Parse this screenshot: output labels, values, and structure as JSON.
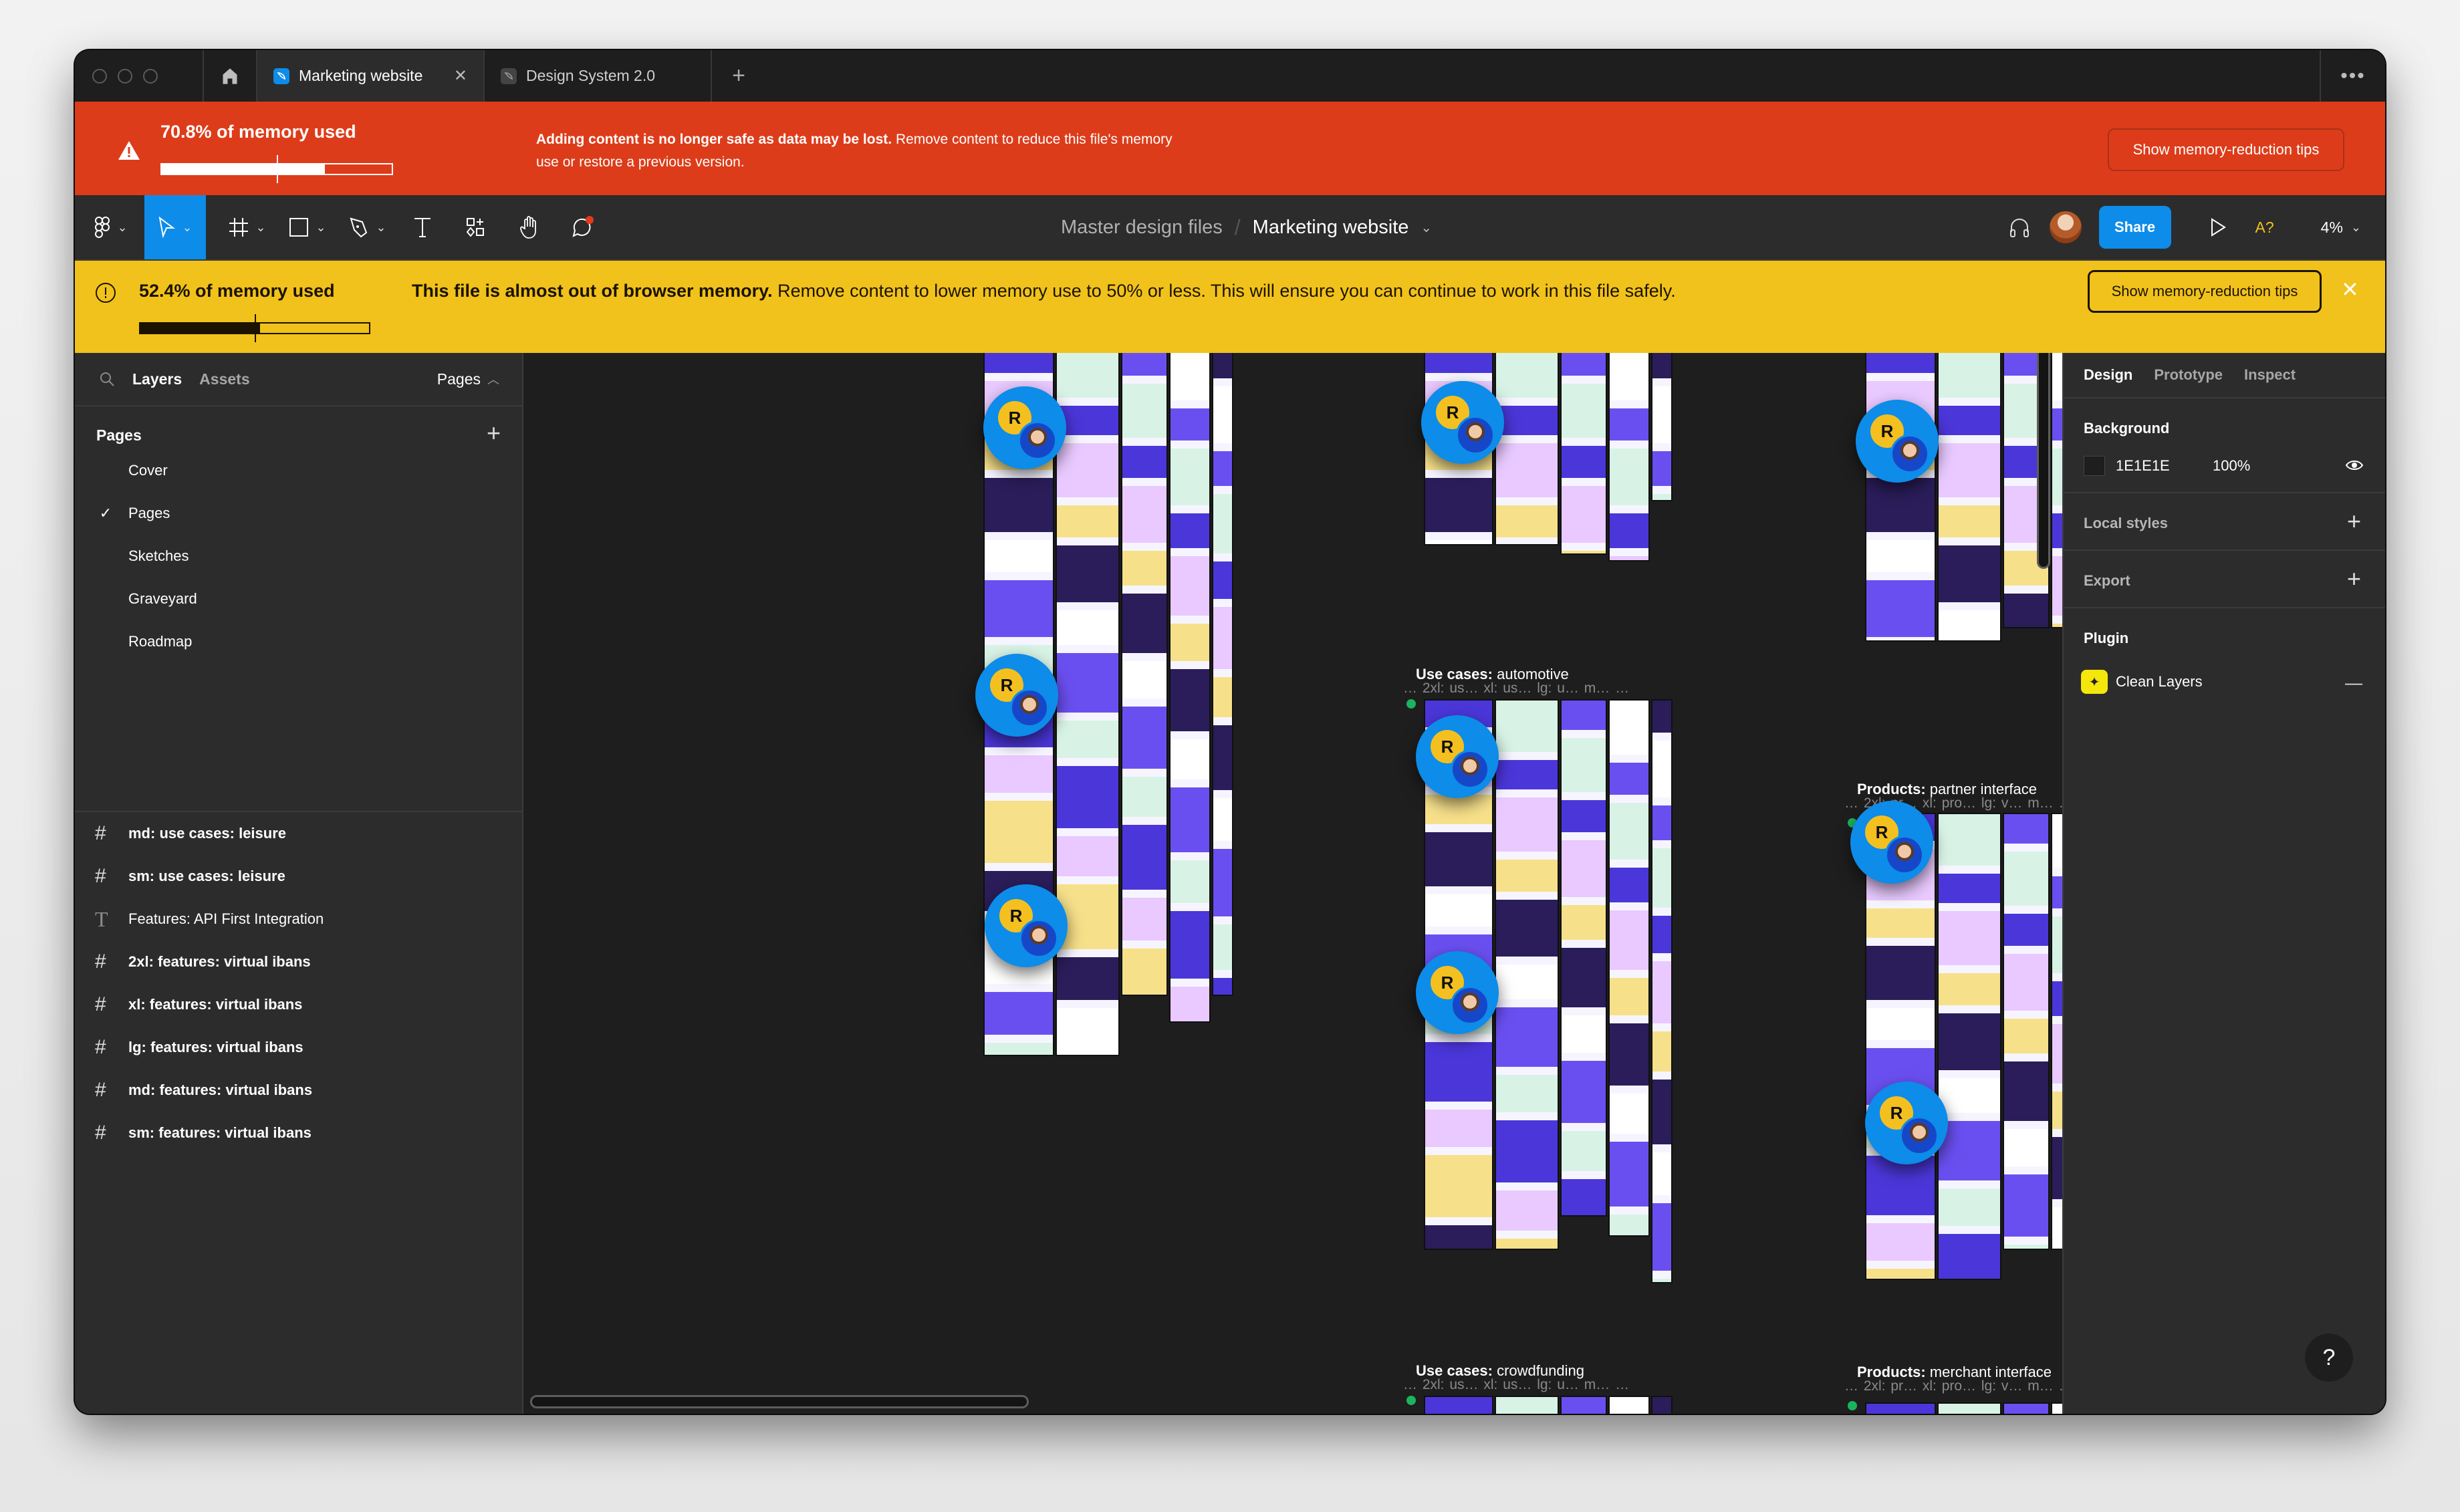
{
  "window": {
    "tabs": [
      {
        "label": "Marketing website",
        "active": true,
        "close_icon": "close-icon"
      },
      {
        "label": "Design System 2.0",
        "active": false
      }
    ],
    "new_tab_label": "+",
    "more_label": "•••"
  },
  "critical_banner": {
    "memory_label": "70.8% of memory used",
    "memory_percent": 70.8,
    "message_bold": "Adding content is no longer safe as data may be lost.",
    "message_rest": " Remove content to reduce this file's memory use or restore a previous version.",
    "button_label": "Show memory-reduction tips",
    "color": "#dd3c1a"
  },
  "toolbar": {
    "tools": [
      "main-menu",
      "move",
      "frame",
      "shape",
      "pen",
      "text",
      "resources",
      "hand",
      "comment"
    ],
    "breadcrumb": {
      "parent": "Master design files",
      "separator": "/",
      "current": "Marketing website"
    },
    "share_label": "Share",
    "a11y_label": "A?",
    "zoom_label": "4%",
    "accent": "#0d8ce9"
  },
  "warning_banner": {
    "memory_label": "52.4% of memory used",
    "memory_percent": 52.4,
    "message_bold": "This file is almost out of browser memory.",
    "message_rest": " Remove content to lower memory use to 50% or less. This will ensure you can continue to work in this file safely.",
    "button_label": "Show memory-reduction tips",
    "color": "#f1c21b"
  },
  "left_panel": {
    "tabs": {
      "layers": "Layers",
      "assets": "Assets"
    },
    "pages_toggle": "Pages",
    "pages_heading": "Pages",
    "add_page_label": "+",
    "pages": [
      {
        "label": "Cover",
        "selected": false
      },
      {
        "label": "Pages",
        "selected": true
      },
      {
        "label": "Sketches",
        "selected": false
      },
      {
        "label": "Graveyard",
        "selected": false
      },
      {
        "label": "Roadmap",
        "selected": false
      }
    ],
    "check_glyph": "✓",
    "layers": [
      {
        "type": "frame",
        "label": "md: use cases: leisure"
      },
      {
        "type": "frame",
        "label": "sm: use cases: leisure"
      },
      {
        "type": "text",
        "label": "Features: API First Integration"
      },
      {
        "type": "frame",
        "label": "2xl: features: virtual ibans"
      },
      {
        "type": "frame",
        "label": "xl: features: virtual ibans"
      },
      {
        "type": "frame",
        "label": "lg: features: virtual ibans"
      },
      {
        "type": "frame",
        "label": "md: features: virtual ibans"
      },
      {
        "type": "frame",
        "label": "sm: features: virtual ibans"
      }
    ],
    "frame_glyph": "#",
    "text_glyph": "T"
  },
  "canvas": {
    "sections": [
      {
        "title_bold": "Use cases:",
        "title_rest": " automotive",
        "subs": "… 2xl: us…   xl: us…   lg: u…   m…     …"
      },
      {
        "title_bold": "Products:",
        "title_rest": " partner interface",
        "subs": "… 2xl: pr…   xl: pro…  lg: v…   m…     …"
      },
      {
        "title_bold": "Use cases:",
        "title_rest": " crowdfunding",
        "subs": "… 2xl: us…   xl: us…   lg: u…   m…     …"
      },
      {
        "title_bold": "Products:",
        "title_rest": " merchant interface",
        "subs": "… 2xl: pr…   xl: pro…  lg: v…   m…     …"
      }
    ],
    "cursor_initial": "R"
  },
  "right_panel": {
    "tabs": {
      "design": "Design",
      "prototype": "Prototype",
      "inspect": "Inspect"
    },
    "background": {
      "heading": "Background",
      "hex": "1E1E1E",
      "opacity": "100%"
    },
    "local_styles": "Local styles",
    "export": "Export",
    "plugin": {
      "heading": "Plugin",
      "name": "Clean Layers"
    },
    "plus_label": "+",
    "minus_label": "—"
  },
  "help_label": "?"
}
